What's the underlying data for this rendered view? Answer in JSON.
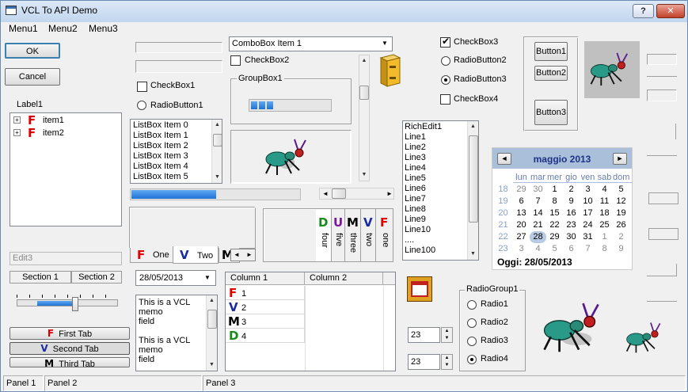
{
  "window": {
    "title": "VCL To API Demo",
    "help_label": "?",
    "close_label": "✕"
  },
  "menu": [
    "Menu1",
    "Menu2",
    "Menu3"
  ],
  "buttons": {
    "ok": "OK",
    "cancel": "Cancel",
    "b1": "Button1",
    "b2": "Button2",
    "b3": "Button3"
  },
  "label1": "Label1",
  "tree": [
    "item1",
    "item2"
  ],
  "edit3_placeholder": "Edit3",
  "header_sections": [
    "Section 1",
    "Section 2"
  ],
  "tab_buttons": [
    "First Tab",
    "Second Tab",
    "Third Tab"
  ],
  "checkbox1": "CheckBox1",
  "radiobutton1": "RadioButton1",
  "listbox": [
    "ListBox Item 0",
    "ListBox Item 1",
    "ListBox Item 2",
    "ListBox Item 3",
    "ListBox Item 4",
    "ListBox Item 5"
  ],
  "tabs_bottom": [
    "One",
    "Two"
  ],
  "tabs_side": [
    "four",
    "five",
    "three",
    "two",
    "one"
  ],
  "date_picker": "28/05/2013",
  "memo": [
    "This is a VCL",
    "memo",
    "field",
    "",
    "This is a VCL",
    "memo",
    "field"
  ],
  "combobox": "ComboBox Item 1",
  "checkbox2": "CheckBox2",
  "groupbox1": "GroupBox1",
  "grid": {
    "columns": [
      "Column 1",
      "Column 2"
    ],
    "rows": [
      "1",
      "2",
      "3",
      "4"
    ]
  },
  "checkbox3": "CheckBox3",
  "radiobutton2": "RadioButton2",
  "radiobutton3": "RadioButton3",
  "checkbox4": "CheckBox4",
  "richedit": [
    "RichEdit1",
    "Line1",
    "Line2",
    "Line3",
    "Line4",
    "Line5",
    "Line6",
    "Line7",
    "Line8",
    "Line9",
    "Line10",
    "....",
    "Line100"
  ],
  "calendar": {
    "title": "maggio 2013",
    "weekdays": [
      "lun",
      "mar",
      "mer",
      "gio",
      "ven",
      "sab",
      "dom"
    ],
    "weeks": [
      {
        "n": "18",
        "days": [
          "29",
          "30",
          "1",
          "2",
          "3",
          "4",
          "5"
        ]
      },
      {
        "n": "19",
        "days": [
          "6",
          "7",
          "8",
          "9",
          "10",
          "11",
          "12"
        ]
      },
      {
        "n": "20",
        "days": [
          "13",
          "14",
          "15",
          "16",
          "17",
          "18",
          "19"
        ]
      },
      {
        "n": "21",
        "days": [
          "20",
          "21",
          "22",
          "23",
          "24",
          "25",
          "26"
        ]
      },
      {
        "n": "22",
        "days": [
          "27",
          "28",
          "29",
          "30",
          "31",
          "1",
          "2"
        ]
      },
      {
        "n": "23",
        "days": [
          "3",
          "4",
          "5",
          "6",
          "7",
          "8",
          "9"
        ]
      }
    ],
    "today": "Oggi: 28/05/2013"
  },
  "radiogroup": {
    "title": "RadioGroup1",
    "items": [
      "Radio1",
      "Radio2",
      "Radio3",
      "Radio4"
    ]
  },
  "spin_values": [
    "23",
    "23"
  ],
  "status": [
    "Panel 1",
    "Panel 2",
    "Panel 3"
  ],
  "colors": {
    "accent": "#1f73d6",
    "calendar_header": "#aabfd9",
    "title_text": "#1e3287"
  }
}
